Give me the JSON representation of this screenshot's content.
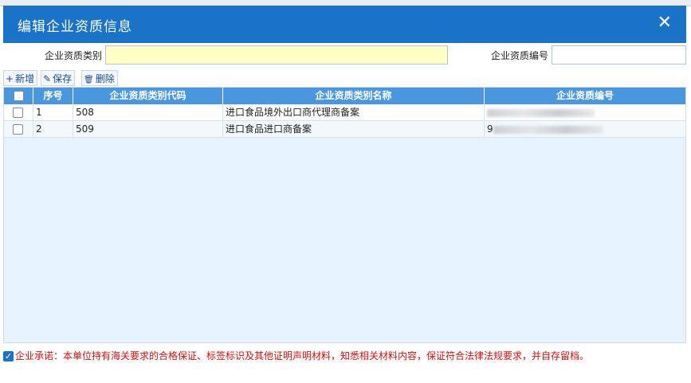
{
  "dialog": {
    "title": "编辑企业资质信息",
    "close_glyph": "✕"
  },
  "form": {
    "category_label": "企业资质类别",
    "category_value": "",
    "number_label": "企业资质编号",
    "number_value": ""
  },
  "toolbar": {
    "add": {
      "icon": "+",
      "label": "新增"
    },
    "save": {
      "icon": "✎",
      "label": "保存"
    },
    "delete": {
      "icon": "🗑",
      "label": "删除"
    }
  },
  "table": {
    "headers": {
      "seq": "序号",
      "code": "企业资质类别代码",
      "name": "企业资质类别名称",
      "number": "企业资质编号"
    },
    "rows": [
      {
        "seq": "1",
        "code": "508",
        "name": "进口食品境外出口商代理商备案",
        "number_prefix": "",
        "number_redacted": true
      },
      {
        "seq": "2",
        "code": "509",
        "name": "进口食品进口商备案",
        "number_prefix": "9",
        "number_redacted": true
      }
    ]
  },
  "pledge": {
    "checked": true,
    "check_glyph": "✓",
    "text": "企业承诺：本单位持有海关要求的合格保证、标签标识及其他证明声明材料，知悉相关材料内容，保证符合法律法规要求，并自存留档。"
  },
  "colors": {
    "title_bar": "#1a73c7",
    "grid_header": "#4a97de",
    "grid_bg": "#e6f2fd",
    "required_input": "#ffffc6",
    "pledge_text": "#d41010"
  }
}
